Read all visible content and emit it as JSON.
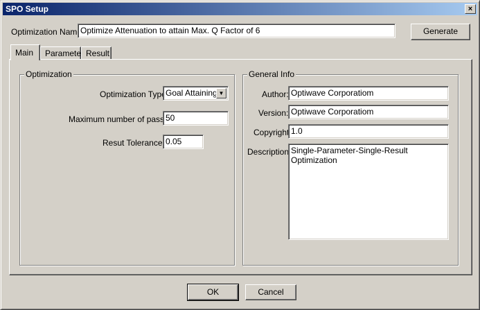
{
  "window": {
    "title": "SPO Setup",
    "close_label": "×"
  },
  "header": {
    "optimization_name_label": "Optimization Name:",
    "optimization_name_value": "Optimize Attenuation to attain Max. Q Factor of 6",
    "generate_label": "Generate"
  },
  "tabs": [
    {
      "label": "Main",
      "active": true
    },
    {
      "label": "Parameter",
      "active": false
    },
    {
      "label": "Result",
      "active": false
    }
  ],
  "optimization": {
    "group_title": "Optimization",
    "type_label": "Optimization Type:",
    "type_value": "Goal Attaining",
    "passes_label": "Maximum number of passes:",
    "passes_value": "50",
    "tolerance_label": "Resut Tolerance:",
    "tolerance_value": "0.05"
  },
  "general_info": {
    "group_title": "General Info",
    "author_label": "Author:",
    "author_value": "Optiwave Corporatiom",
    "version_label": "Version:",
    "version_value": "Optiwave Corporatiom",
    "copyright_label": "Copyright:",
    "copyright_value": "1.0",
    "description_label": "Description:",
    "description_value": "Single-Parameter-Single-Result Optimization"
  },
  "footer": {
    "ok_label": "OK",
    "cancel_label": "Cancel"
  },
  "icons": {
    "dropdown": "chevron-down-icon",
    "close": "close-icon"
  }
}
